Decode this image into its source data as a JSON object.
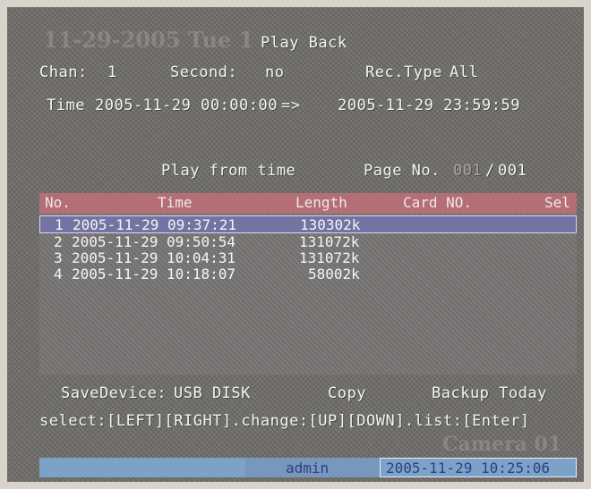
{
  "overlay": {
    "ghost_date": "11-29-2005 Tue 1",
    "ghost_camera": "Camera 01"
  },
  "title": "Play Back",
  "chan": {
    "label": "Chan:",
    "value": "1"
  },
  "second": {
    "label": "Second:",
    "value": "no"
  },
  "rec_type": {
    "label": "Rec.Type",
    "value": "All"
  },
  "time_range": {
    "label": "Time",
    "start": "2005-11-29 00:00:00",
    "arrow": "=>",
    "end": "2005-11-29 23:59:59"
  },
  "play_from_time": "Play from time",
  "page": {
    "label": "Page No.",
    "current": "001",
    "sep": "/",
    "total": "001"
  },
  "table": {
    "headers": {
      "no": "No.",
      "time": "Time",
      "length": "Length",
      "card": "Card NO.",
      "sel": "Sel"
    },
    "rows": [
      {
        "no": "1",
        "time": "2005-11-29 09:37:21",
        "length": "130302k"
      },
      {
        "no": "2",
        "time": "2005-11-29 09:50:54",
        "length": "131072k"
      },
      {
        "no": "3",
        "time": "2005-11-29 10:04:31",
        "length": "131072k"
      },
      {
        "no": "4",
        "time": "2005-11-29 10:18:07",
        "length": "58002k"
      }
    ]
  },
  "save_device": {
    "label": "SaveDevice:",
    "value": "USB DISK"
  },
  "copy_label": "Copy",
  "backup_today_label": "Backup Today",
  "help": "select:[LEFT][RIGHT].change:[UP][DOWN].list:[Enter]",
  "status": {
    "user": "admin",
    "datetime": "2005-11-29 10:25:06"
  },
  "colors": {
    "header_bg": "#b46f76",
    "selected_row": "#7473a3",
    "status_bar": "#7da2c8",
    "status_text": "#2c3f86"
  }
}
